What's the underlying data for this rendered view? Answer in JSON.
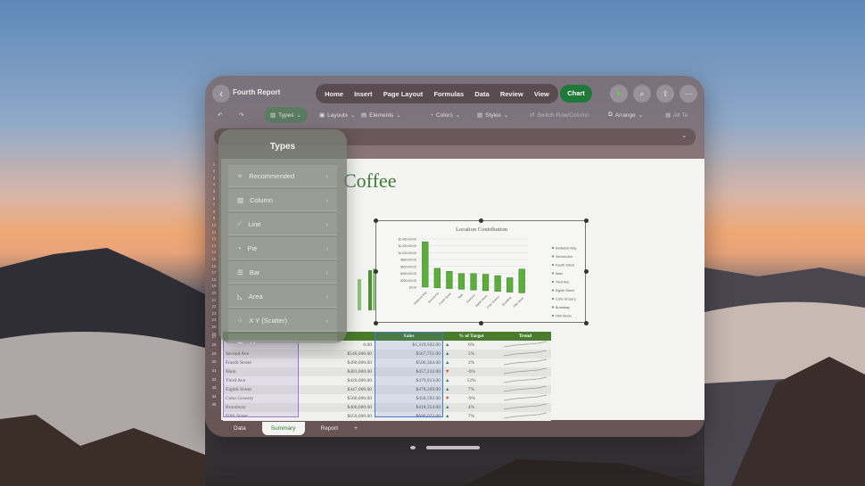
{
  "window": {
    "title": "Fourth Report",
    "tabs": [
      "Home",
      "Insert",
      "Page Layout",
      "Formulas",
      "Data",
      "Review",
      "View"
    ],
    "active_tab": "Chart"
  },
  "toolbar": {
    "types": "Types",
    "layouts": "Layouts",
    "elements": "Elements",
    "colors": "Colors",
    "styles": "Styles",
    "switch": "Switch Row/Column",
    "arrange": "Arrange",
    "alt": "Alt Te"
  },
  "menu": {
    "title": "Types",
    "items": [
      {
        "label": "Recommended",
        "icon": "sparkle-icon"
      },
      {
        "label": "Column",
        "icon": "column-chart-icon"
      },
      {
        "label": "Line",
        "icon": "line-chart-icon"
      },
      {
        "label": "Pie",
        "icon": "pie-chart-icon"
      },
      {
        "label": "Bar",
        "icon": "bar-chart-icon"
      },
      {
        "label": "Area",
        "icon": "area-chart-icon"
      },
      {
        "label": "X Y (Scatter)",
        "icon": "scatter-chart-icon"
      },
      {
        "label": "Maps",
        "icon": "map-icon"
      }
    ]
  },
  "sheet": {
    "title_partial": "Coffee",
    "columns": [
      "Sales",
      "% of Target",
      "Trend"
    ],
    "rows": [
      {
        "name": "",
        "target": "0.00",
        "sales": "$1,319,502.00",
        "pct": "6%",
        "up": true
      },
      {
        "name": "Second Ave",
        "target": "$540,000.00",
        "sales": "$567,751.00",
        "pct": "5%",
        "up": true
      },
      {
        "name": "Fourth Street",
        "target": "$490,000.00",
        "sales": "$500,364.00",
        "pct": "2%",
        "up": true
      },
      {
        "name": "Main",
        "target": "$483,000.00",
        "sales": "$457,212.00",
        "pct": "-6%",
        "up": false
      },
      {
        "name": "Third Ave",
        "target": "$420,000.00",
        "sales": "$479,913.00",
        "pct": "12%",
        "up": true
      },
      {
        "name": "Eighth Street",
        "target": "$447,000.00",
        "sales": "$478,209.00",
        "pct": "7%",
        "up": true
      },
      {
        "name": "Cobo Grocery",
        "target": "$500,000.00",
        "sales": "$458,592.00",
        "pct": "-9%",
        "up": false
      },
      {
        "name": "Broadway",
        "target": "$400,000.00",
        "sales": "$418,354.00",
        "pct": "4%",
        "up": true
      },
      {
        "name": "Fifth Street",
        "target": "$650,000.00",
        "sales": "$690,033.00",
        "pct": "7%",
        "up": true
      }
    ]
  },
  "sheet_tabs": [
    "Data",
    "Summary",
    "Report",
    "+"
  ],
  "colors": {
    "accent": "#1f7a3a",
    "bar": "#5cae3c",
    "header": "#4a7c2e",
    "down": "#d04a2a",
    "up": "#2e8b57"
  },
  "chart_data": {
    "type": "bar",
    "title": "Location Contribution",
    "categories": [
      "Redwood Way",
      "Second Ave",
      "Fourth Street",
      "Main",
      "Third Ave",
      "Eighth Street",
      "Cobo Grocery",
      "Broadway",
      "Fifth Street"
    ],
    "values": [
      1319502,
      567751,
      500364,
      457212,
      479913,
      478209,
      458592,
      418354,
      690033
    ],
    "ylim": [
      0,
      1400000
    ],
    "yticks": [
      "$0.00",
      "$200,000.00",
      "$400,000.00",
      "$600,000.00",
      "$800,000.00",
      "$1,000,000.00",
      "$1,200,000.00",
      "$1,400,000.00"
    ],
    "legend": "right",
    "grid": true
  }
}
